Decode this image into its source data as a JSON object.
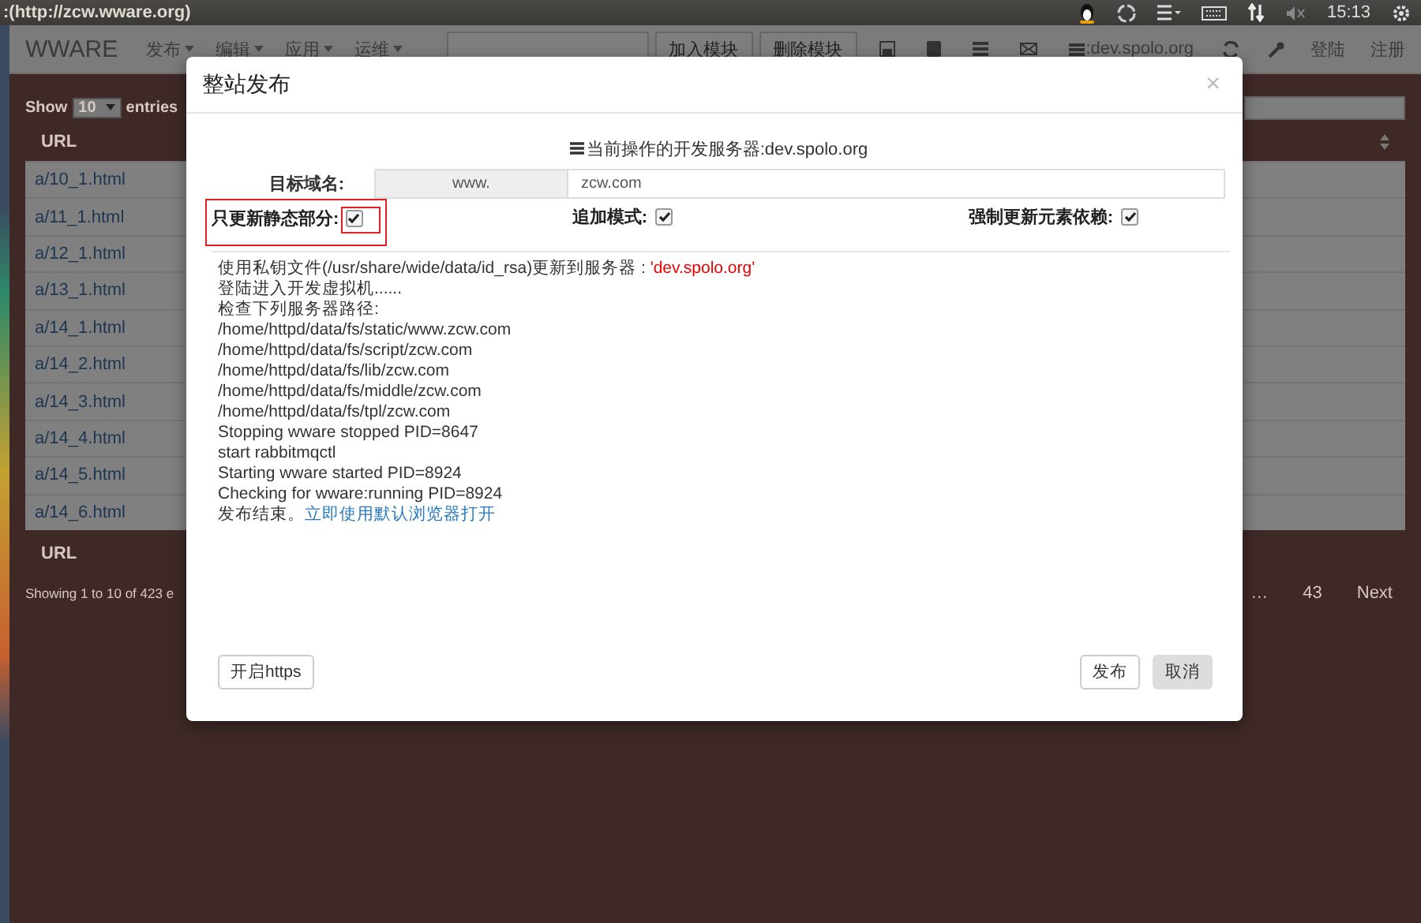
{
  "top_bar": {
    "title": ":(http://zcw.wware.org)",
    "clock": "15:13"
  },
  "navbar": {
    "brand": "WWARE",
    "menus": [
      {
        "label": "发布"
      },
      {
        "label": "编辑"
      },
      {
        "label": "应用"
      },
      {
        "label": "运维"
      }
    ],
    "buttons": [
      "加入模块",
      "删除模块"
    ],
    "server": ":dev.spolo.org",
    "links": [
      "登陆",
      "注册"
    ]
  },
  "table_page": {
    "show_label": "Show",
    "page_size": "10",
    "entries_label": "entries",
    "column": "URL",
    "footer_column": "URL",
    "rows": [
      "a/10_1.html",
      "a/11_1.html",
      "a/12_1.html",
      "a/13_1.html",
      "a/14_1.html",
      "a/14_2.html",
      "a/14_3.html",
      "a/14_4.html",
      "a/14_5.html",
      "a/14_6.html"
    ],
    "info": "Showing 1 to 10 of 423 e",
    "pagination": [
      "…",
      "43",
      "Next"
    ]
  },
  "dialog": {
    "title": "整站发布",
    "close": "×",
    "server_line": "当前操作的开发服务器:dev.spolo.org",
    "domain_label": "目标域名:",
    "domain_prefix": "www.",
    "domain_value": "zcw.com",
    "options": [
      {
        "label": "只更新静态部分:",
        "checked": true,
        "highlighted": true
      },
      {
        "label": "追加模式:",
        "checked": true,
        "highlighted": false
      },
      {
        "label": "强制更新元素依赖:",
        "checked": true,
        "highlighted": false
      }
    ],
    "log": [
      {
        "text": "使用私钥文件(/usr/share/wide/data/id_rsa)更新到服务器 : ",
        "emphasis": "'dev.spolo.org'"
      },
      {
        "text": "登陆进入开发虚拟机......"
      },
      {
        "text": "检查下列服务器路径:"
      },
      {
        "text": "/home/httpd/data/fs/static/www.zcw.com"
      },
      {
        "text": "/home/httpd/data/fs/script/zcw.com"
      },
      {
        "text": "/home/httpd/data/fs/lib/zcw.com"
      },
      {
        "text": "/home/httpd/data/fs/middle/zcw.com"
      },
      {
        "text": "/home/httpd/data/fs/tpl/zcw.com"
      },
      {
        "text": "Stopping wware stopped PID=8647"
      },
      {
        "text": "start rabbitmqctl"
      },
      {
        "text": "Starting wware started PID=8924"
      },
      {
        "text": "Checking for wware:running PID=8924"
      },
      {
        "text": "发布结束。",
        "link": "立即使用默认浏览器打开"
      }
    ],
    "footer_buttons": [
      {
        "label": "开启https",
        "kind": "default"
      },
      {
        "label": "发布",
        "kind": "default"
      },
      {
        "label": "取消",
        "kind": "muted"
      }
    ]
  }
}
